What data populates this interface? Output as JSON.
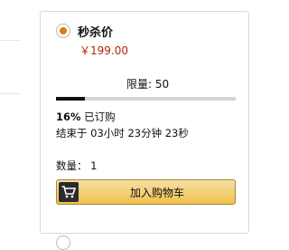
{
  "deal": {
    "title": "秒杀价",
    "price": "￥199.00",
    "limit_label": "限量: 50",
    "claimed_percent": 0.16,
    "claimed_pct_text": "16%",
    "claimed_text": " 已订购",
    "ends_text": "结束于 03小时 23分钟 23秒",
    "quantity_label": "数量：",
    "quantity_value": "1",
    "add_to_cart_label": "加入购物车"
  },
  "colors": {
    "accent": "#e47911",
    "price": "#b12704",
    "button_top": "#f7dfa5",
    "button_bottom": "#f0c14b"
  },
  "icons": {
    "radio_selected": "radio-selected-icon",
    "cart": "shopping-cart-icon"
  }
}
